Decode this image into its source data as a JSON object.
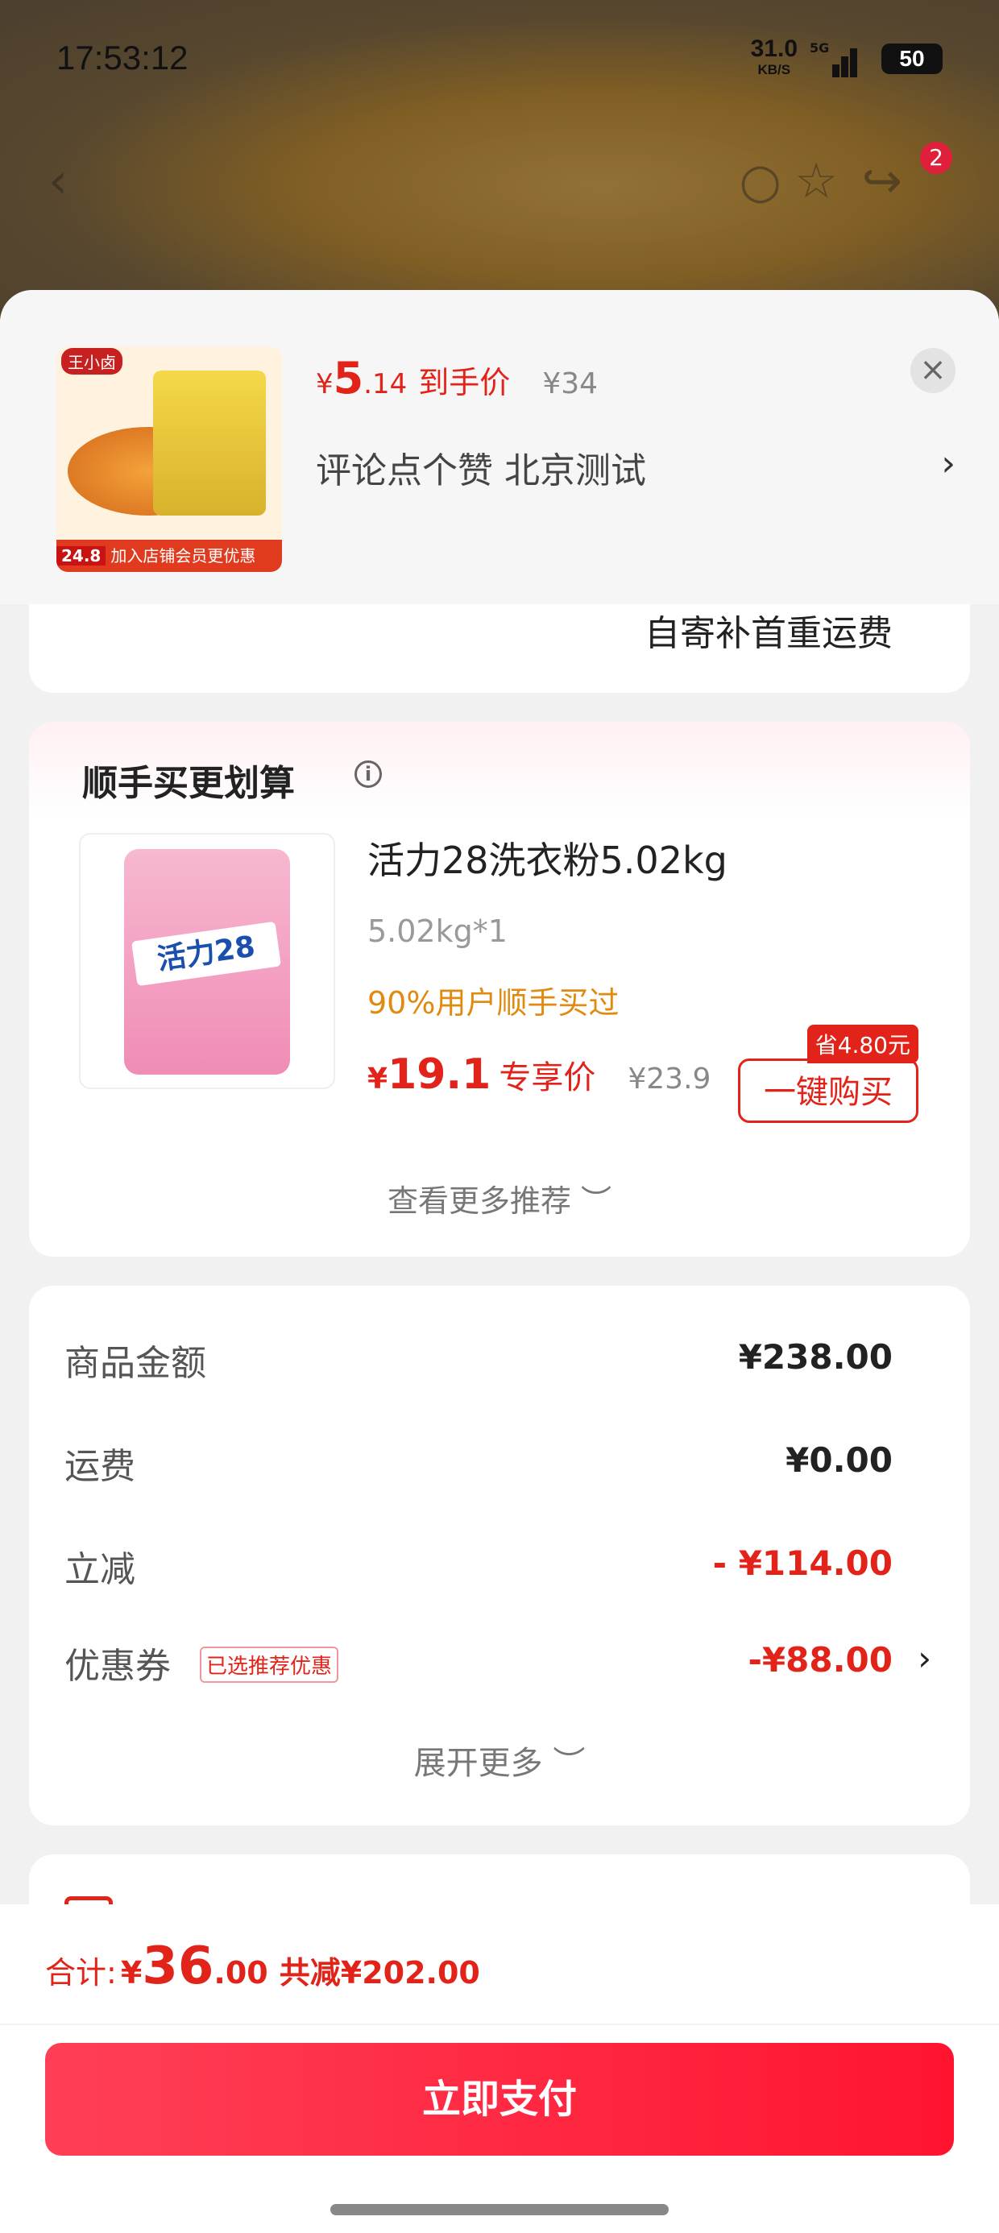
{
  "status_bar": {
    "time": "17:53:12",
    "net_speed": "31.0",
    "net_unit": "KB/S",
    "sig1_label": "5G",
    "sig2_label": "5G",
    "battery": "50"
  },
  "nav": {
    "cart_badge": "2"
  },
  "product": {
    "image_brand": "王小卤",
    "image_price_tag": "24.8",
    "image_banner": "加入店铺会员更优惠",
    "price_yen": "¥",
    "price_int": "5",
    "price_dec": ".14",
    "price_tag": "到手价",
    "original_price": "¥34",
    "spec": "评论点个赞  北京测试",
    "close_icon": "close-icon",
    "spec_arrow": "›"
  },
  "shipping": {
    "text": "自寄补首重运费"
  },
  "recommend": {
    "title": "顺手买更划算",
    "item": {
      "image_logo": "活力28",
      "name": "活力28洗衣粉5.02kg",
      "spec": "5.02kg*1",
      "social": "90%用户顺手买过",
      "price_yen": "¥",
      "price_int": "19.1",
      "price_tag": "专享价",
      "original_price": "¥23.9",
      "save_badge": "省4.80元",
      "buy_label": "一键购买"
    },
    "more_label": "查看更多推荐 ︶"
  },
  "summary": {
    "rows": [
      {
        "label": "商品金额",
        "value": "¥238.00"
      },
      {
        "label": "运费",
        "value": "¥0.00"
      },
      {
        "label": "立减",
        "value": "- ¥114.00"
      },
      {
        "label": "优惠券",
        "tag": "已选推荐优惠",
        "value": "-¥88.00"
      }
    ],
    "expand_label": "展开更多 ︶"
  },
  "footer": {
    "total_label": "合计:",
    "total_yen": "¥",
    "total_int": "36",
    "total_dec": ".00",
    "saved": "共减¥202.00",
    "pay_label": "立即支付"
  },
  "colors": {
    "accent": "#e2231a",
    "pay_button": "#ff1f3a",
    "social_orange": "#e08a10"
  }
}
